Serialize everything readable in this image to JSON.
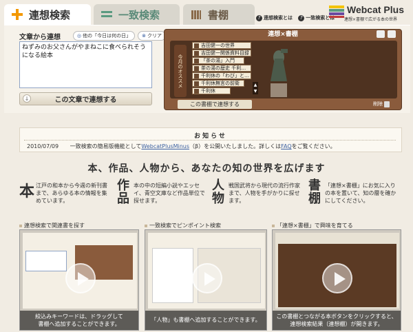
{
  "tabs": [
    {
      "label": "連想検索"
    },
    {
      "label": "一致検索"
    },
    {
      "label": "書棚"
    }
  ],
  "header_links": {
    "about_assoc": "連想検索とは",
    "about_match": "一致検索とは"
  },
  "logo": {
    "title": "Webcat Plus",
    "subtitle": "連想×書棚で広がる本の世界"
  },
  "search": {
    "label": "文章から連想",
    "today_chip": "他の「今日は何の日」",
    "clear": "クリア",
    "text": "ねずみのお父さんがやまねこに食べられそうになる絵本",
    "submit": "この文章で連想する"
  },
  "shelf": {
    "title": "連想×書棚",
    "side_label": "今月のオススメ",
    "books": [
      "吉田健一の世界",
      "吉田健一関係資料目録",
      "「茶の湯」入門",
      "茶の湯の歴史 千利…",
      "千利休の「わび」と…",
      "千利休無言の前衛",
      "千利休"
    ],
    "assoc_button": "この書棚で連想する",
    "delete": "削除"
  },
  "news": {
    "title": "お知らせ",
    "date": "2010/07/09",
    "text_before": "一致検索の簡易版機能として",
    "link1": "WebcatPlusMinus",
    "text_mid": "（β）を公開いたしました。詳しくは",
    "link2": "FAQ",
    "text_after": "をご覧ください。"
  },
  "heading": "本、作品、人物から、あなたの知の世界を広げます",
  "features": [
    {
      "kanji": "本",
      "text": "江戸の和本から今週の新刊書まで、あらゆる本の情報を集めています。"
    },
    {
      "kanji": "作品",
      "text": "本の中の短編小説やエッセイ、青空文庫など作品単位で探せます。"
    },
    {
      "kanji": "人物",
      "text": "戦国武将から現代の流行作家まで、人物を手がかりに探せます。"
    },
    {
      "kanji": "書棚",
      "text": "「連想×書棚」にお気に入りの本を置いて、知の層を確かにしてください。"
    }
  ],
  "videos": [
    {
      "heading": "連想検索で関連書を探す",
      "caption_1": "絞込みキーワードは、ドラッグして",
      "caption_2": "書棚へ追加することができます。"
    },
    {
      "heading": "一致検索でピンポイント検索",
      "caption_1": "「人物」も書棚へ追加することができます。",
      "caption_2": ""
    },
    {
      "heading": "「連想×書棚」で興味を育てる",
      "caption_1": "この書棚とつながる本ボタンをクリックすると、",
      "caption_2": "連想検索結果（連想棚）が開きます。"
    }
  ],
  "colors": {
    "accent_orange": "#f39800",
    "accent_green": "#5a9a80",
    "shelf_brown": "#8a5b3c"
  }
}
